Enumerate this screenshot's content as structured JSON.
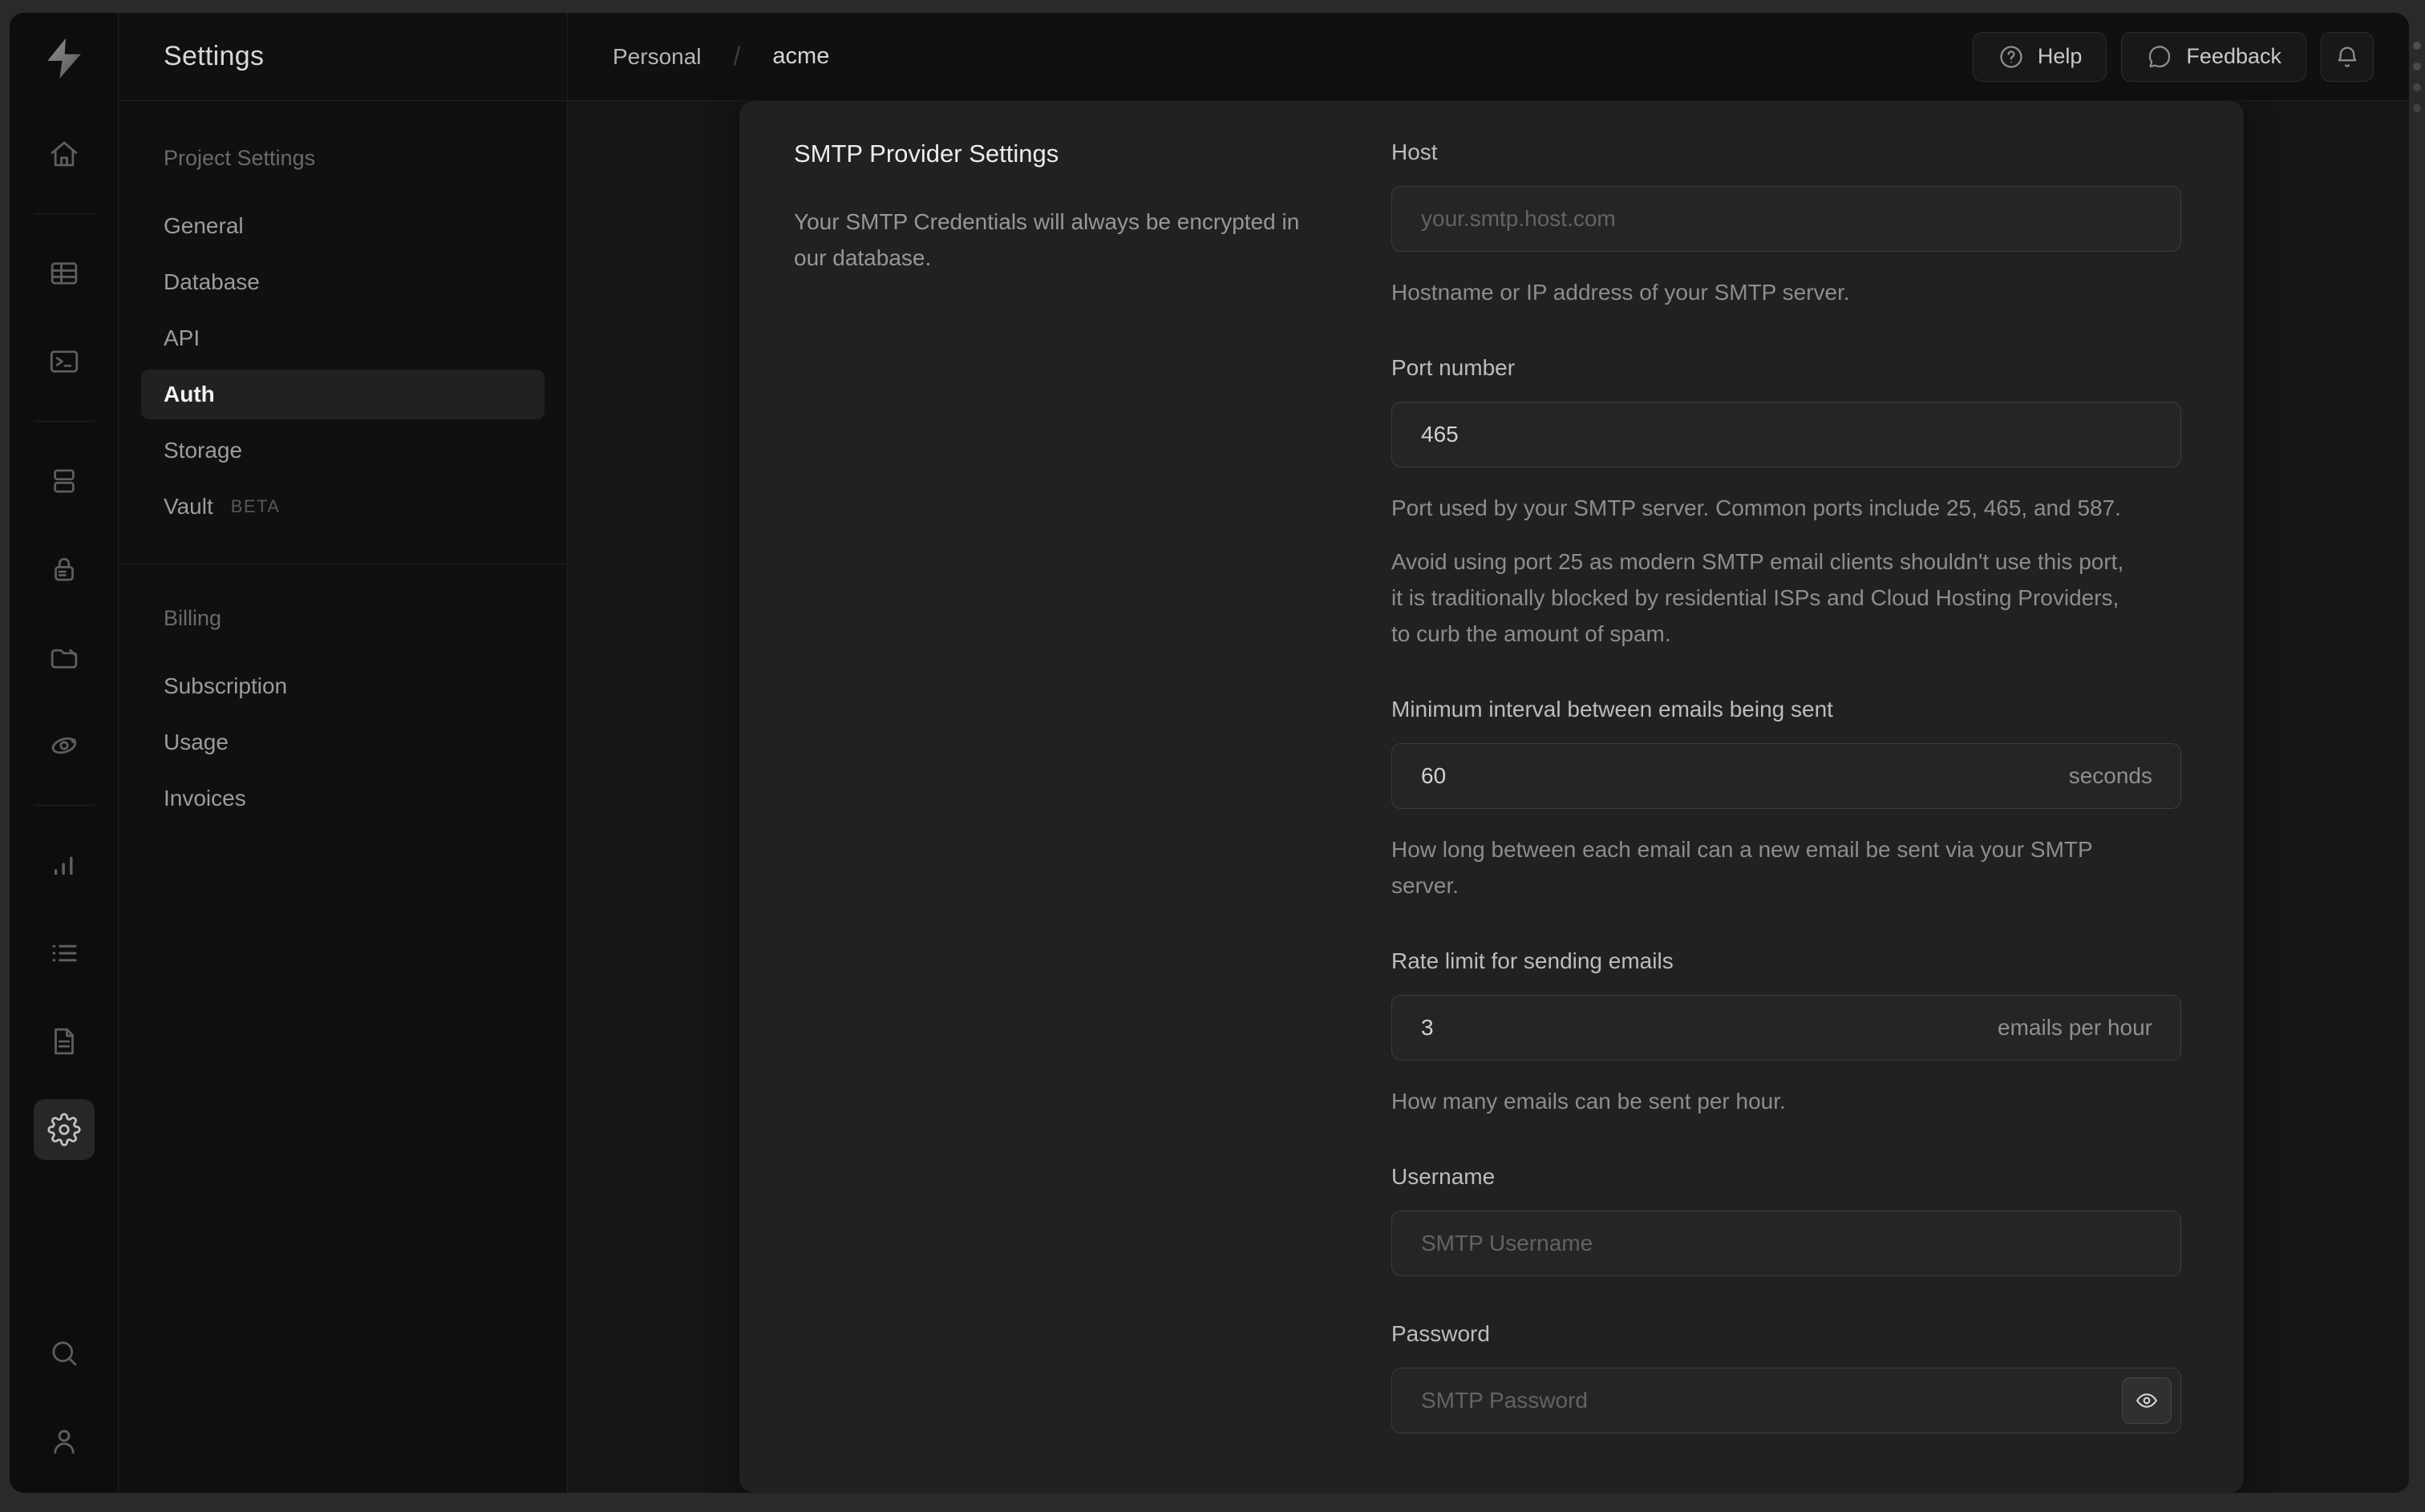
{
  "theme": {
    "outer_bg": "#2a2a2a",
    "window_bg": "#101010",
    "rail_bg": "#0d0d0d",
    "content_bg": "#151515",
    "card_bg": "#212121",
    "input_bg": "#252525",
    "input_border": "#3c3c3c",
    "divider": "#1f1f1f",
    "text_primary": "#ececec",
    "text_secondary": "#8d8d8d",
    "text_muted": "#636363"
  },
  "rail": {
    "icons": [
      "supabase-logo",
      "home",
      "table-editor",
      "sql-editor",
      "database",
      "auth",
      "storage",
      "edge-functions",
      "reports",
      "logs",
      "docs",
      "settings",
      "search",
      "user"
    ],
    "active": "settings"
  },
  "nav": {
    "title": "Settings",
    "sections": [
      {
        "header": "Project Settings",
        "items": [
          {
            "label": "General"
          },
          {
            "label": "Database"
          },
          {
            "label": "API"
          },
          {
            "label": "Auth",
            "active": true
          },
          {
            "label": "Storage"
          },
          {
            "label": "Vault",
            "badge": "BETA"
          }
        ]
      },
      {
        "header": "Billing",
        "items": [
          {
            "label": "Subscription"
          },
          {
            "label": "Usage"
          },
          {
            "label": "Invoices"
          }
        ]
      }
    ]
  },
  "header": {
    "breadcrumb": {
      "org": "Personal",
      "separator": "/",
      "project": "acme"
    },
    "help_label": "Help",
    "feedback_label": "Feedback"
  },
  "panel": {
    "title": "SMTP Provider Settings",
    "description": "Your SMTP Credentials will always be encrypted in our database.",
    "fields": [
      {
        "label": "Host",
        "placeholder": "your.smtp.host.com",
        "helpers": [
          "Hostname or IP address of your SMTP server."
        ]
      },
      {
        "label": "Port number",
        "value": "465",
        "helpers": [
          "Port used by your SMTP server. Common ports include 25, 465, and 587.",
          "Avoid using port 25 as modern SMTP email clients shouldn't use this port, it is traditionally blocked by residential ISPs and Cloud Hosting Providers, to curb the amount of spam."
        ]
      },
      {
        "label": "Minimum interval between emails being sent",
        "value": "60",
        "suffix": "seconds",
        "helpers": [
          "How long between each email can a new email be sent via your SMTP server."
        ]
      },
      {
        "label": "Rate limit for sending emails",
        "value": "3",
        "suffix": "emails per hour",
        "helpers": [
          "How many emails can be sent per hour."
        ]
      },
      {
        "label": "Username",
        "placeholder": "SMTP Username",
        "helpers": []
      },
      {
        "label": "Password",
        "placeholder": "SMTP Password",
        "helpers": []
      }
    ]
  }
}
